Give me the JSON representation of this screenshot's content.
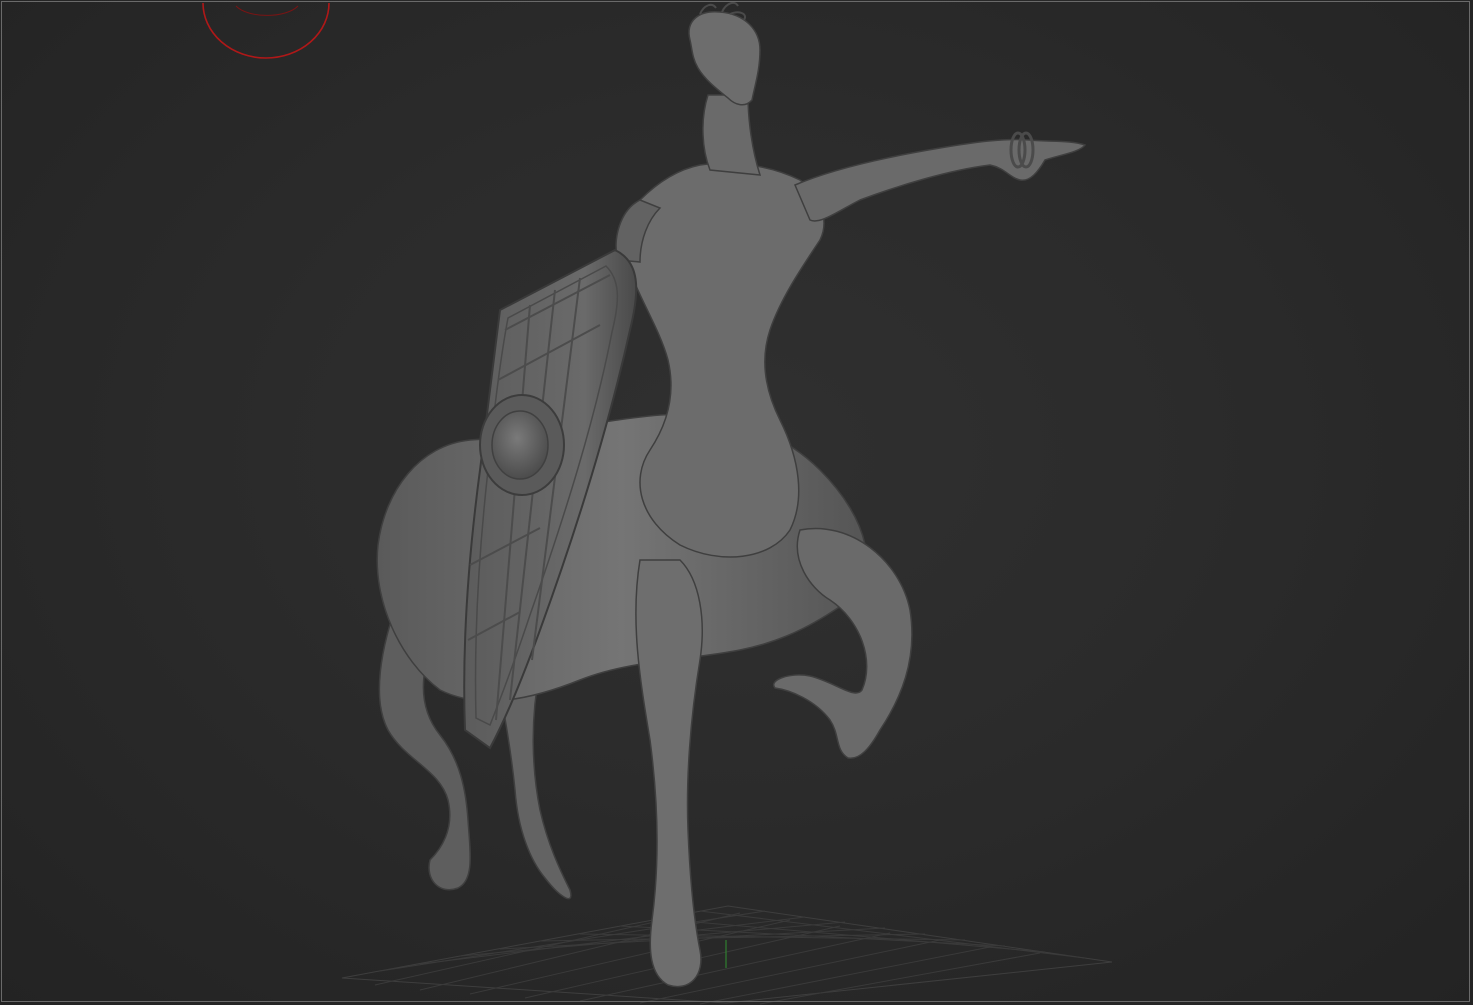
{
  "app": {
    "window_title": ""
  },
  "viewport": {
    "background": "#2a2a2a",
    "border_color": "#6a6a6a",
    "model": {
      "subject": "centaur-sculpt",
      "material_color": "#6b6b6b"
    },
    "navigation_gizmo": {
      "color": "#b01818"
    },
    "ground_grid": {
      "color": "#3c3c3c",
      "axis_color": "#2f8f2f"
    }
  }
}
